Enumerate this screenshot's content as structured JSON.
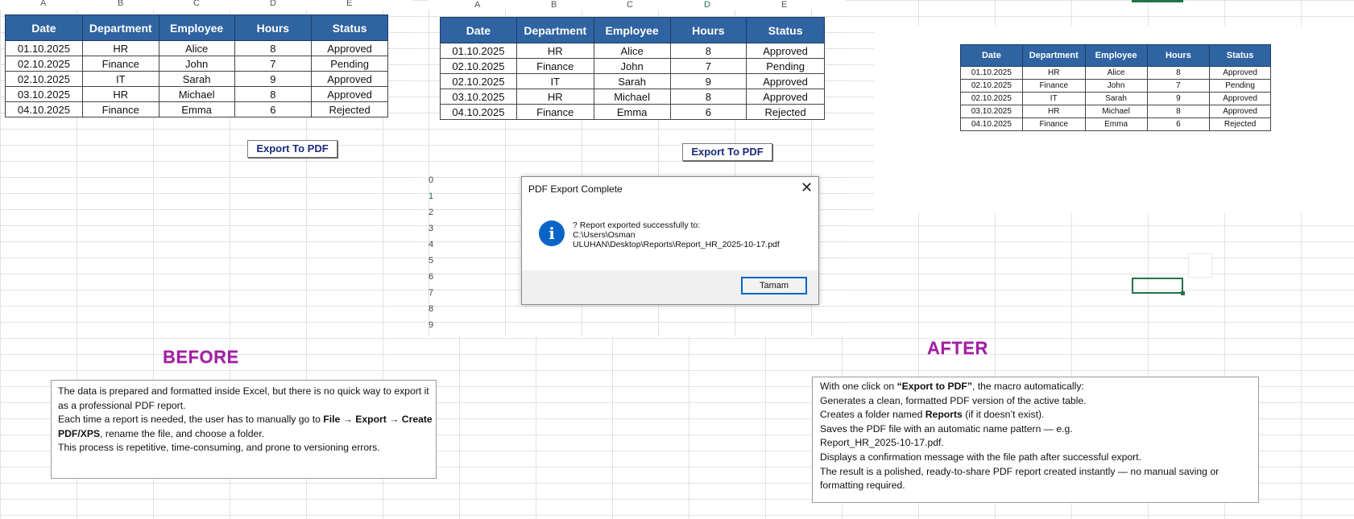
{
  "table": {
    "headers": [
      "Date",
      "Department",
      "Employee",
      "Hours",
      "Status"
    ],
    "rows": [
      [
        "01.10.2025",
        "HR",
        "Alice",
        "8",
        "Approved"
      ],
      [
        "02.10.2025",
        "Finance",
        "John",
        "7",
        "Pending"
      ],
      [
        "02.10.2025",
        "IT",
        "Sarah",
        "9",
        "Approved"
      ],
      [
        "03.10.2025",
        "HR",
        "Michael",
        "8",
        "Approved"
      ],
      [
        "04.10.2025",
        "Finance",
        "Emma",
        "6",
        "Rejected"
      ]
    ]
  },
  "column_letters": [
    "A",
    "B",
    "C",
    "D",
    "E"
  ],
  "row_numbers": [
    "0",
    "1",
    "2",
    "3",
    "4",
    "5",
    "6",
    "7",
    "8",
    "9"
  ],
  "export_button_label": "Export To PDF",
  "dialog": {
    "title": "PDF Export Complete",
    "close_glyph": "✕",
    "icon_glyph": "i",
    "message_lines": [
      "? Report exported successfully to:",
      "C:\\Users\\Osman",
      "ULUHAN\\Desktop\\Reports\\Report_HR_2025-10-17.pdf"
    ],
    "ok_label": "Tamam"
  },
  "before": {
    "heading": "BEFORE",
    "text": "The data is prepared and formatted inside Excel, but there is no quick way to export it as a professional PDF report.",
    "path_pre": "Each time a report is needed, the user has to manually go to ",
    "path_bold": "File → Export → Create PDF/XPS",
    "path_post": ", rename the file, and choose a folder.",
    "closing": "This process is repetitive, time-consuming, and prone to versioning errors."
  },
  "after": {
    "heading": "AFTER",
    "intro_pre": "With one click on ",
    "intro_bold": "“Export to PDF”",
    "intro_post": ", the macro automatically:",
    "line1": "Generates a clean, formatted PDF version of the active table.",
    "line2_pre": "Creates a folder named ",
    "line2_bold": "Reports",
    "line2_post": " (if it doesn’t exist).",
    "line3": "Saves the PDF file with an automatic name pattern — e.g. Report_HR_2025-10-17.pdf.",
    "line4": "Displays a confirmation message with the file path after successful export.",
    "line5": "The result is a polished, ready-to-share PDF report created instantly — no manual saving or formatting required."
  },
  "colors": {
    "header_fill": "#2f63a1",
    "heading_purple": "#a020a0",
    "dialog_accent": "#0a64c8",
    "excel_green": "#217346"
  }
}
